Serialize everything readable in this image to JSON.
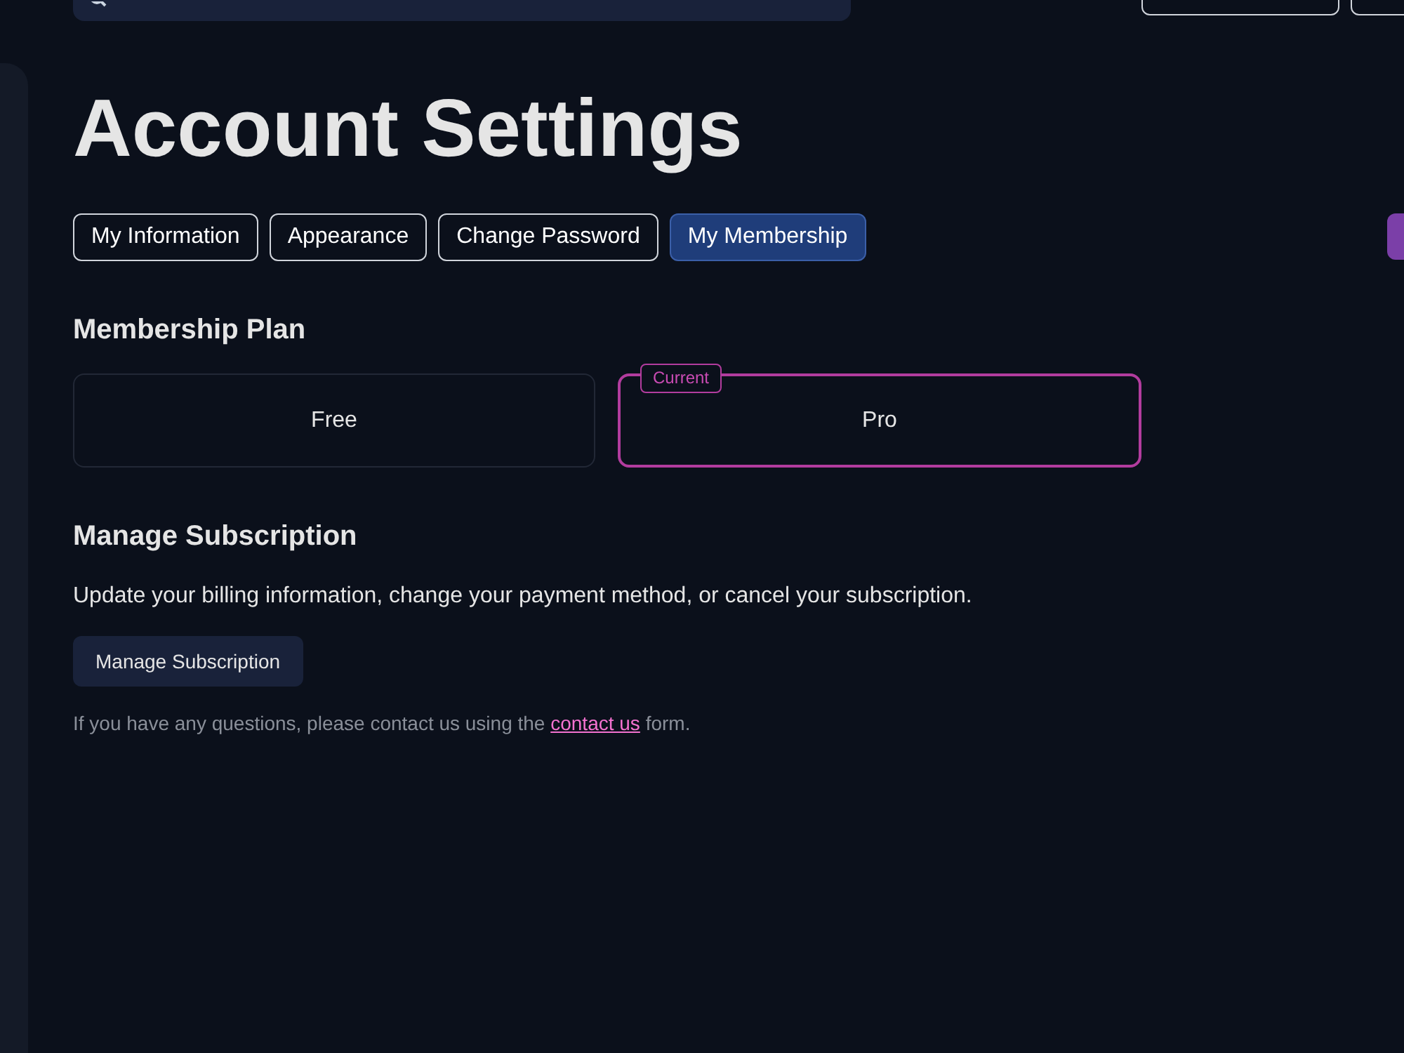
{
  "page_title": "Account Settings",
  "tabs": [
    {
      "label": "My Information",
      "selected": false
    },
    {
      "label": "Appearance",
      "selected": false
    },
    {
      "label": "Change Password",
      "selected": false
    },
    {
      "label": "My Membership",
      "selected": true
    }
  ],
  "membership_plan": {
    "heading": "Membership Plan",
    "plans": [
      {
        "name": "Free",
        "current": false
      },
      {
        "name": "Pro",
        "current": true,
        "badge": "Current"
      }
    ]
  },
  "manage_subscription": {
    "heading": "Manage Subscription",
    "description": "Update your billing information, change your payment method, or cancel your subscription.",
    "button": "Manage Subscription"
  },
  "contact_note": {
    "before": "If you have any questions, please contact us using the",
    "link": "contact us",
    "after": "form."
  }
}
